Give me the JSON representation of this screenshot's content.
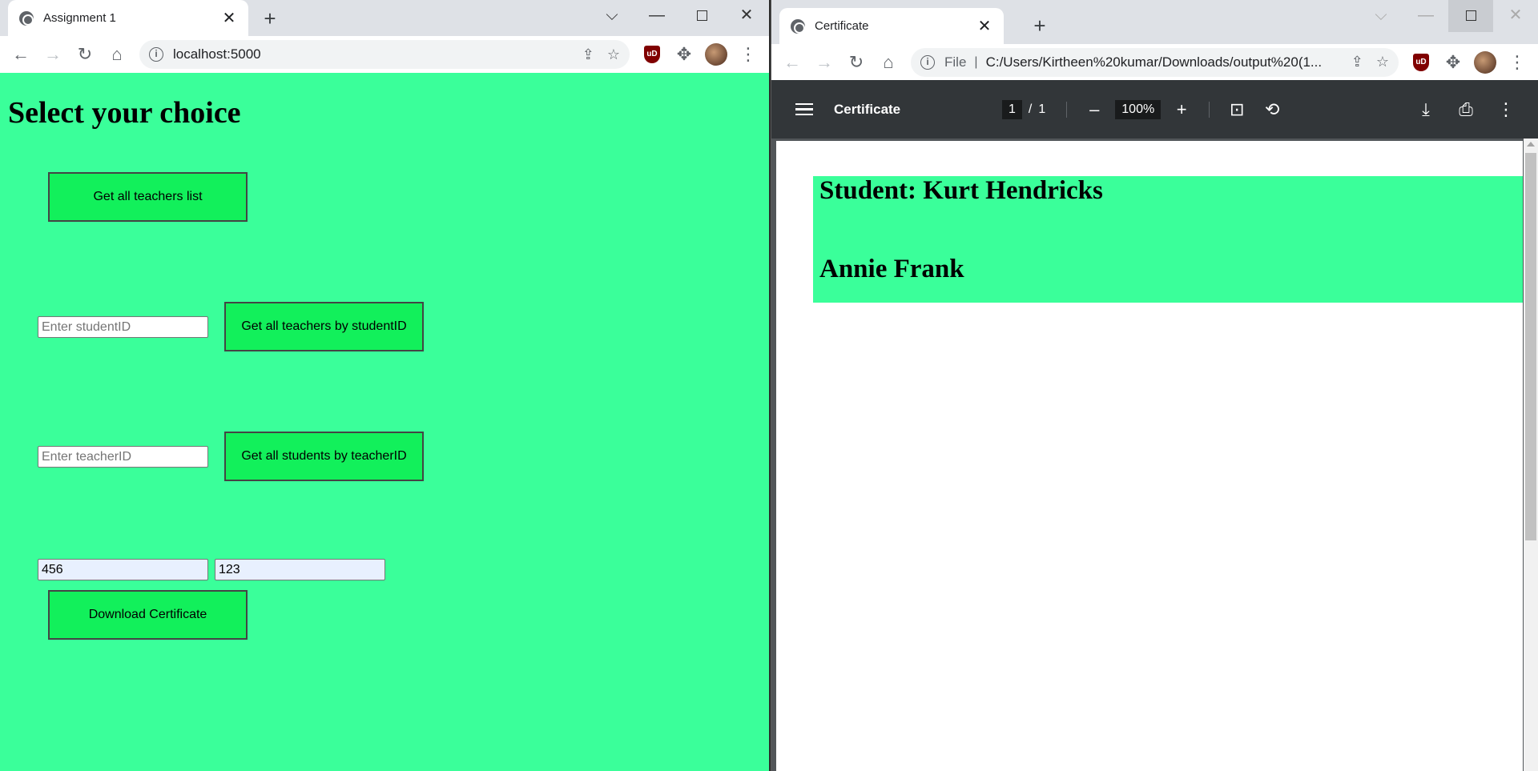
{
  "left_window": {
    "tab": {
      "title": "Assignment 1",
      "close": "✕"
    },
    "new_tab": "+",
    "controls": {
      "dropdown": "⌵",
      "minimize": "—",
      "close": "✕"
    },
    "address": {
      "url": "localhost:5000"
    },
    "page": {
      "heading": "Select your choice",
      "btn_all_teachers": "Get all teachers list",
      "student_id_placeholder": "Enter studentID",
      "btn_teachers_by_student": "Get all teachers by studentID",
      "teacher_id_placeholder": "Enter teacherID",
      "btn_students_by_teacher": "Get all students by teacherID",
      "cert_student_value": "456",
      "cert_teacher_value": "123",
      "btn_download": "Download Certificate"
    },
    "colors": {
      "page_bg": "#3aff9a",
      "button_bg": "#12f05b"
    }
  },
  "right_window": {
    "tab": {
      "title": "Certificate",
      "close": "✕"
    },
    "new_tab": "+",
    "controls": {
      "dropdown": "⌵",
      "minimize": "—",
      "close": "✕"
    },
    "address": {
      "scheme": "File",
      "url": "C:/Users/Kirtheen%20kumar/Downloads/output%20(1..."
    },
    "pdf": {
      "title": "Certificate",
      "page_current": "1",
      "page_sep": "/",
      "page_total": "1",
      "zoom": "100%",
      "zoom_out": "–",
      "zoom_in": "+",
      "student_line": "Student: Kurt Hendricks",
      "teacher_line": "Annie Frank"
    }
  }
}
